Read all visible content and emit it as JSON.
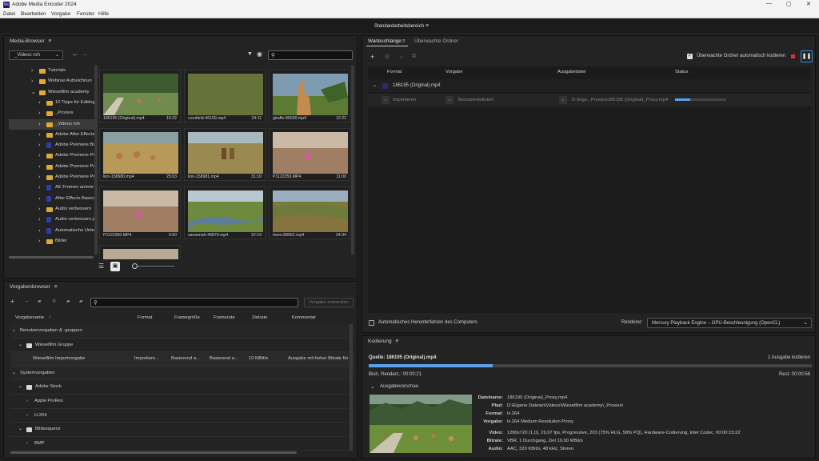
{
  "window": {
    "title": "Adobe Media Encoder 2024",
    "controls": [
      "—",
      "▢",
      "✕"
    ]
  },
  "menu": [
    "Datei",
    "Bearbeiten",
    "Vorgabe",
    "Fenster",
    "Hilfe"
  ],
  "workspace": {
    "label": "Standardarbeitsbereich"
  },
  "media_browser": {
    "title": "Media-Browser",
    "location": "_Videos roh",
    "tree": [
      {
        "label": "Tutorials",
        "type": "folder"
      },
      {
        "label": "Webinar Aufzeichnun",
        "type": "folder"
      },
      {
        "label": "Wieselfilm academy",
        "type": "folder",
        "expanded": true
      },
      {
        "label": "10 Tipps für Editing",
        "type": "folder"
      },
      {
        "label": "_Proxies",
        "type": "folder"
      },
      {
        "label": "_Videos roh",
        "type": "folder",
        "selected": true
      },
      {
        "label": "Adobe After Effects",
        "type": "folder"
      },
      {
        "label": "Adobe Premiere Bi",
        "type": "doc"
      },
      {
        "label": "Adobe Premiere Pr",
        "type": "folder"
      },
      {
        "label": "Adobe Premiere Pr",
        "type": "folder"
      },
      {
        "label": "Adobe Premiere Pr",
        "type": "folder"
      },
      {
        "label": "AE Fromen animie",
        "type": "doc"
      },
      {
        "label": "After Effects Basics",
        "type": "doc"
      },
      {
        "label": "Audio verbessern",
        "type": "folder"
      },
      {
        "label": "Audio verbessern.p",
        "type": "doc"
      },
      {
        "label": "Automatische Unte",
        "type": "doc"
      },
      {
        "label": "Bilder",
        "type": "folder"
      }
    ],
    "clips": [
      {
        "name": "186195 (Original).mp4",
        "duration": "15:22",
        "scene": "meadow"
      },
      {
        "name": "cornfield-46169.mp4",
        "duration": "24:11",
        "scene": "grass"
      },
      {
        "name": "giraffe-85690.mp4",
        "duration": "12:22",
        "scene": "giraffe"
      },
      {
        "name": "lion-158980.mp4",
        "duration": "25:03",
        "scene": "lions"
      },
      {
        "name": "lion-158981.mp4",
        "duration": "31:10",
        "scene": "lion2"
      },
      {
        "name": "P1122359.MP4",
        "duration": "11:00",
        "scene": "floor"
      },
      {
        "name": "P1122360.MP4",
        "duration": "9:00",
        "scene": "floor"
      },
      {
        "name": "savannah-46879.mp4",
        "duration": "22:19",
        "scene": "river"
      },
      {
        "name": "trees-89562.mp4",
        "duration": "24:34",
        "scene": "hills"
      }
    ]
  },
  "presets": {
    "title": "Vorgabenbrowser",
    "apply_label": "Vorgabe anwenden",
    "columns": [
      "Vorgabename",
      "Format",
      "Framegröße",
      "Framerate",
      "Zielrate",
      "Kommentar"
    ],
    "rows": [
      {
        "label": "Benutzervorgaben & -gruppen",
        "level": 0,
        "chev": "⌄"
      },
      {
        "label": "Wieselfilm Gruppe",
        "level": 1,
        "chev": "⌄",
        "icon": "folder"
      },
      {
        "label": "Wieselfilm Importvorgabe",
        "level": 2,
        "format": "Importiere...",
        "size": "Basierend a...",
        "rate": "Basierend a...",
        "target": "10 MBit/s",
        "comment": "Ausgabe mit hoher Bitrate für K"
      },
      {
        "label": "Systemvorgaben",
        "level": 0,
        "chev": "⌄"
      },
      {
        "label": "Adobe Stock",
        "level": 1,
        "chev": "⌄",
        "icon": "stock"
      },
      {
        "label": "Apple ProRes",
        "level": 2,
        "chev": "›"
      },
      {
        "label": "H.264",
        "level": 2,
        "chev": "›"
      },
      {
        "label": "Bildsequenz",
        "level": 1,
        "chev": "⌄",
        "icon": "seq"
      },
      {
        "label": "BMP",
        "level": 2,
        "chev": "›"
      }
    ]
  },
  "queue": {
    "tabs": [
      "Warteschlange",
      "Überwachte Ordner"
    ],
    "auto_encode_label": "Überwachte Ordner automatisch kodieren",
    "columns": [
      "Format",
      "Vorgabe",
      "Ausgabedatei",
      "Status"
    ],
    "item": {
      "name": "186195 (Original).mp4",
      "format": "Importieren",
      "preset": "Benutzerdefiniert",
      "output": "D:\\Eige...Proxies\\186195 (Original)_Proxy.mp4",
      "progress": 0.3
    },
    "shutdown_label": "Automatisches Herunterfahren des Computers",
    "renderer_label": "Renderer:",
    "renderer_value": "Mercury Playback Engine – GPU-Beschleunigung (OpenCL)"
  },
  "encoding": {
    "title": "Kodierung",
    "source": "Quelle: 186195 (Original).mp4",
    "outputs": "1 Ausgabe kodieren",
    "elapsed": "Bish. Renderz.: 00:00:21",
    "remaining": "Rest: 00:00:56",
    "progress": 0.28,
    "preview_label": "Ausgabevorschau",
    "details": [
      {
        "k": "Dateiname:",
        "v": "186195 (Original)_Proxy.mp4"
      },
      {
        "k": "Pfad:",
        "v": "D:\\Eigene Dateien\\Videos\\Wieselfilm academy\\_Proxies\\"
      },
      {
        "k": "Format:",
        "v": "H.264"
      },
      {
        "k": "Vorgabe:",
        "v": "H.264 Medium Resolution Proxy"
      },
      {
        "k": "Video:",
        "v": "1280x720 (1,0), 29,97 fps, Progressive, 203 (75% HLG, 58% PQ), Hardware-Codierung, Intel Codec, 00:00:15:22"
      },
      {
        "k": "Bitrate:",
        "v": "VBR, 1 Durchgang, Ziel 10,00 MBit/s"
      },
      {
        "k": "Audio:",
        "v": "AAC, 320 KBit/s, 48 kHz, Stereo"
      }
    ]
  }
}
